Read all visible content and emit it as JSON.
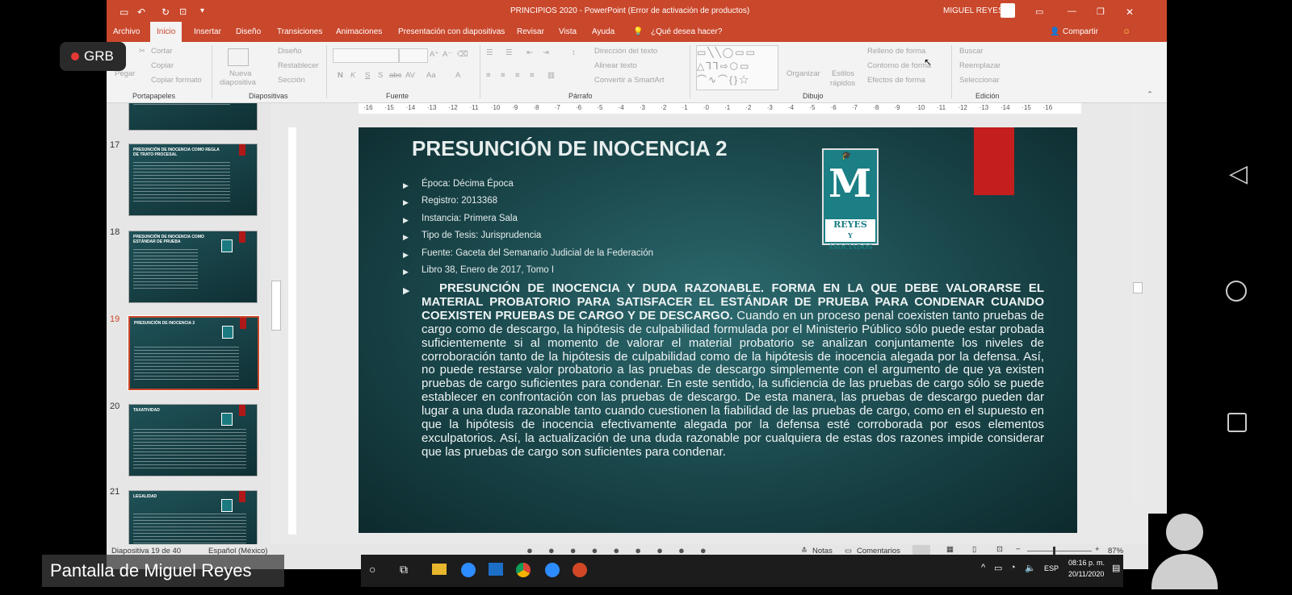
{
  "window": {
    "doc_title": "PRINCIPIOS 2020 - PowerPoint (Error de activación de productos)",
    "user": "MIGUEL REYES"
  },
  "tabs": [
    "Archivo",
    "Inicio",
    "Insertar",
    "Diseño",
    "Transiciones",
    "Animaciones",
    "Presentación con diapositivas",
    "Revisar",
    "Vista",
    "Ayuda",
    "¿Qué desea hacer?"
  ],
  "share_label": "Compartir",
  "ribbon": {
    "portapapeles": {
      "pegar": "Pegar",
      "cortar": "Cortar",
      "copiar": "Copiar",
      "copiar_formato": "Copiar formato",
      "label": "Portapapeles"
    },
    "diapositivas": {
      "nueva": "Nueva",
      "diapositiva": "diapositiva",
      "diseno": "Diseño",
      "restablecer": "Restablecer",
      "seccion": "Sección",
      "label": "Diapositivas"
    },
    "fuente": {
      "label": "Fuente",
      "n": "N",
      "k": "K",
      "s": "S",
      "abc": "abc",
      "av": "AV",
      "aa": "Aa",
      "a": "A"
    },
    "parrafo": {
      "direccion": "Dirección del texto",
      "alinear": "Alinear texto",
      "convertir": "Convertir a SmartArt",
      "label": "Párrafo"
    },
    "dibujo": {
      "organizar": "Organizar",
      "estilos": "Estilos",
      "rapidos": "rápidos",
      "relleno": "Relleno de forma",
      "contorno": "Contorno de forma",
      "efectos": "Efectos de forma",
      "label": "Dibujo"
    },
    "edicion": {
      "buscar": "Buscar",
      "reemplazar": "Reemplazar",
      "seleccionar": "Seleccionar",
      "label": "Edición"
    }
  },
  "ruler_ticks": [
    "·16",
    "·15",
    "·14",
    "·13",
    "·12",
    "·11",
    "·10",
    "·9",
    "·8",
    "·7",
    "·6",
    "·5",
    "·4",
    "·3",
    "·2",
    "·1",
    "·0",
    "·1",
    "·2",
    "·3",
    "·4",
    "·5",
    "·6",
    "·7",
    "·8",
    "·9",
    "·10",
    "·11",
    "·12",
    "·13",
    "·14",
    "·15",
    "·16"
  ],
  "thumbnails": [
    {
      "num": "",
      "title": ""
    },
    {
      "num": "17",
      "title": "PRESUNCIÓN DE INOCENCIA COMO REGLA DE TRATO PROCESAL"
    },
    {
      "num": "18",
      "title": "PRESUNCIÓN DE INOCENCIA COMO ESTÁNDAR DE PRUEBA"
    },
    {
      "num": "19",
      "title": "PRESUNCIÓN DE INOCENCIA 2"
    },
    {
      "num": "20",
      "title": "TAXATIVIDAD"
    },
    {
      "num": "21",
      "title": "LEGALIDAD"
    }
  ],
  "slide": {
    "title": "PRESUNCIÓN DE INOCENCIA 2",
    "logo_text_1": "REYES",
    "logo_text_2": "Y ASOCIADOS",
    "bullets": [
      "Época: Décima Época",
      "Registro: 2013368",
      "Instancia: Primera Sala",
      "Tipo de Tesis: Jurisprudencia",
      "Fuente: Gaceta del Semanario Judicial de la Federación",
      "Libro 38, Enero de 2017, Tomo I"
    ],
    "para_bold": "PRESUNCIÓN DE INOCENCIA Y DUDA RAZONABLE. FORMA EN LA QUE DEBE VALORARSE EL MATERIAL PROBATORIO PARA SATISFACER EL ESTÁNDAR DE PRUEBA PARA CONDENAR CUANDO COEXISTEN PRUEBAS DE CARGO Y DE DESCARGO.",
    "para_text": "Cuando en un proceso penal coexisten tanto pruebas de cargo como de descargo, la hipótesis de culpabilidad formulada por el Ministerio Público sólo puede estar probada suficientemente si al momento de valorar el material probatorio se analizan conjuntamente los niveles de corroboración tanto de la hipótesis de culpabilidad como de la hipótesis de inocencia alegada por la defensa. Así, no puede restarse valor probatorio a las pruebas de descargo simplemente con el argumento de que ya existen pruebas de cargo suficientes para condenar. En este sentido, la suficiencia de las pruebas de cargo sólo se puede establecer en confrontación con las pruebas de descargo. De esta manera, las pruebas de descargo pueden dar lugar a una duda razonable tanto cuando cuestionen la fiabilidad de las pruebas de cargo, como en el supuesto en que la hipótesis de inocencia efectivamente alegada por la defensa esté corroborada por esos elementos exculpatorios. Así, la actualización de una duda razonable por cualquiera de estas dos razones impide considerar que las pruebas de cargo son suficientes para condenar."
  },
  "status": {
    "slide_counter": "Diapositiva 19 de 40",
    "language": "Español (México)",
    "notas": "Notas",
    "comentarios": "Comentarios",
    "zoom": "87%"
  },
  "taskbar": {
    "lang": "ESP",
    "time": "08:16 p. m.",
    "date": "20/11/2020"
  },
  "overlay": {
    "recording": "GRB",
    "presenter": "Pantalla de Miguel Reyes"
  }
}
